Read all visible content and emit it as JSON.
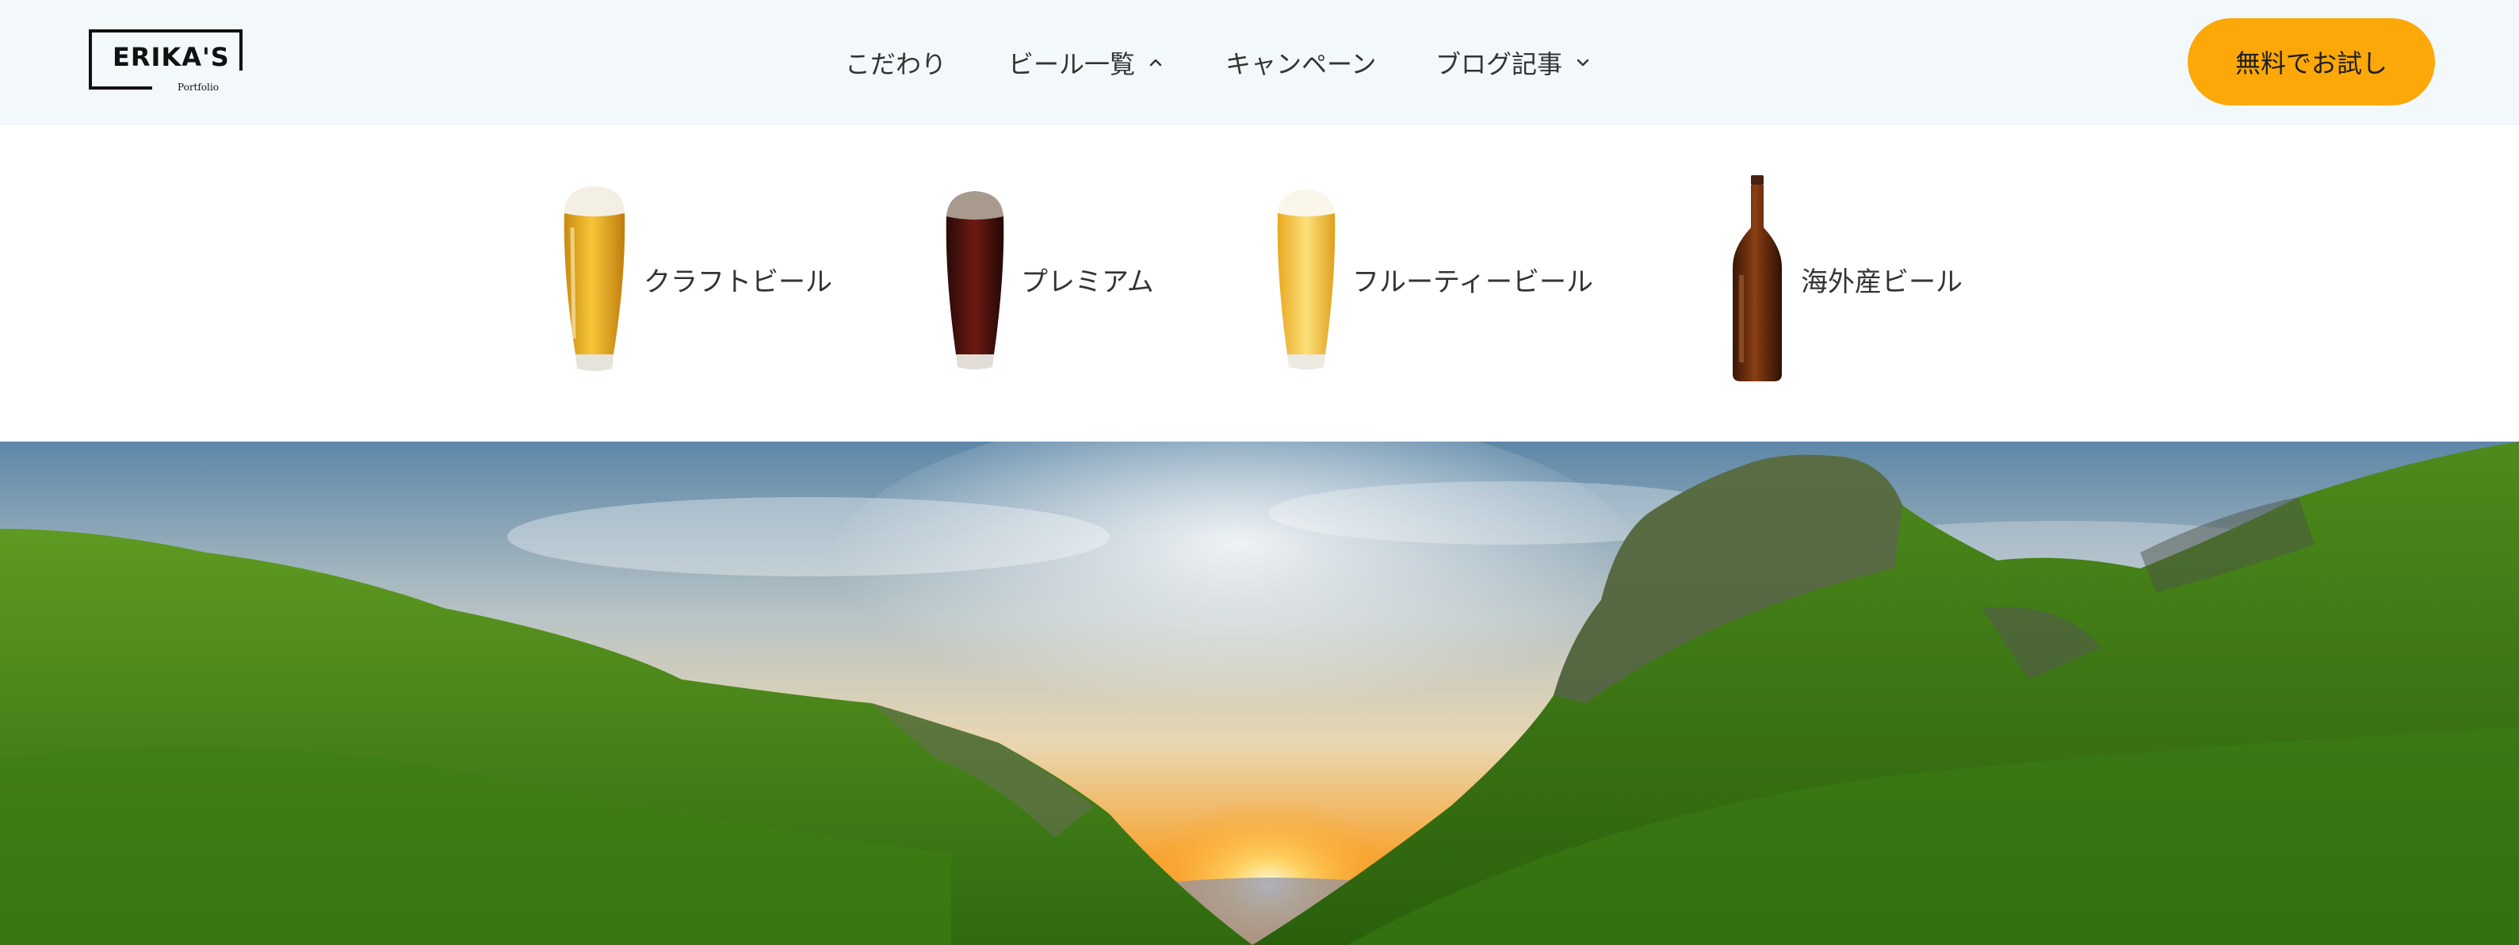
{
  "brand": {
    "name": "ERIKA'S",
    "tagline": "Portfolio"
  },
  "nav": {
    "items": [
      {
        "label": "こだわり",
        "has_dropdown": false
      },
      {
        "label": "ビール一覧",
        "has_dropdown": true,
        "expanded": true
      },
      {
        "label": "キャンペーン",
        "has_dropdown": false
      },
      {
        "label": "ブログ記事",
        "has_dropdown": true,
        "expanded": false
      }
    ],
    "cta_label": "無料でお試し"
  },
  "dropdown": {
    "items": [
      {
        "label": "クラフトビール",
        "icon": "craft-beer-glass-icon"
      },
      {
        "label": "プレミアム",
        "icon": "premium-dark-beer-glass-icon"
      },
      {
        "label": "フルーティービール",
        "icon": "fruity-beer-glass-icon"
      },
      {
        "label": "海外産ビール",
        "icon": "beer-bottle-icon"
      }
    ]
  },
  "colors": {
    "header_bg": "#f3f8fb",
    "cta_bg": "#fba808",
    "text": "#333333"
  },
  "hero": {
    "image": "green-valley-sunset-landscape"
  }
}
